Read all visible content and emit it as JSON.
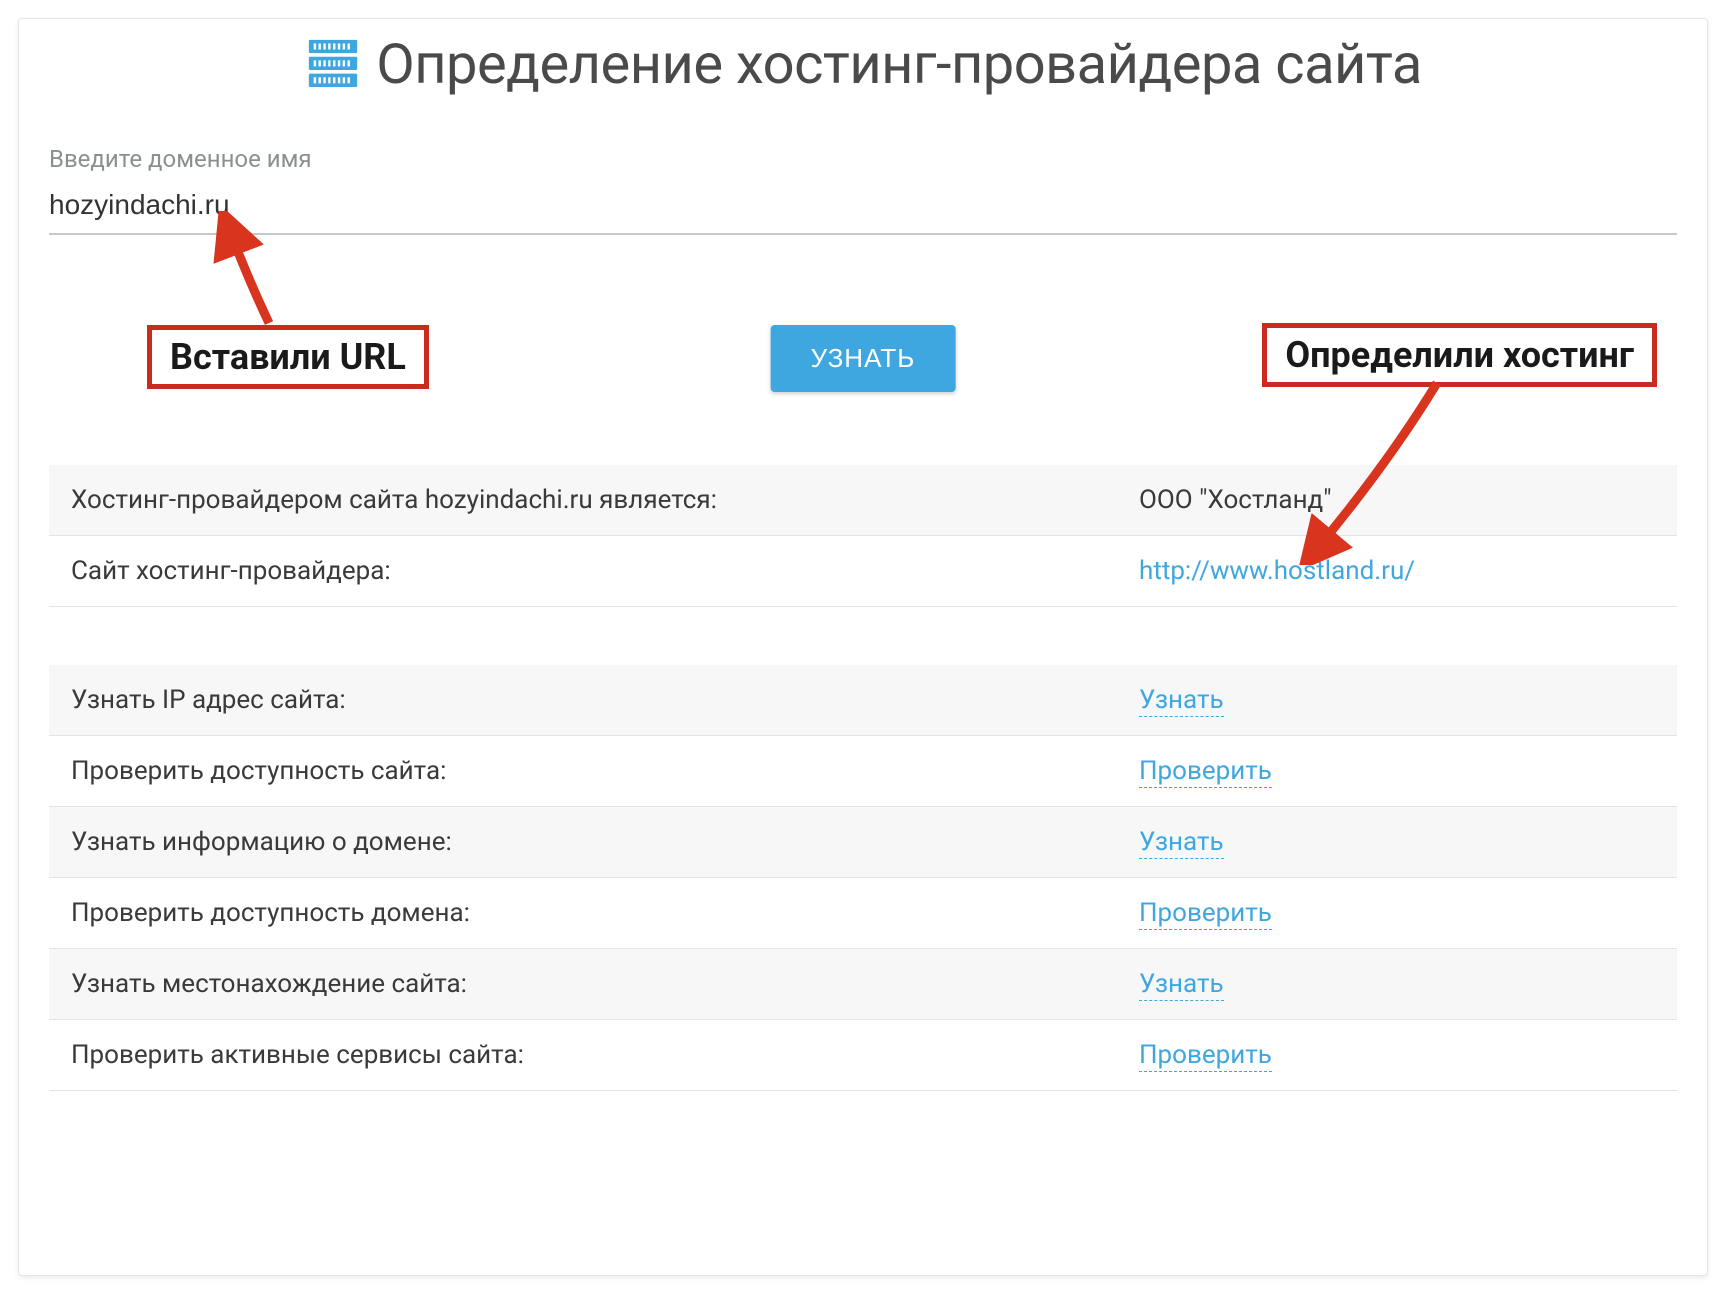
{
  "header": {
    "title": "Определение хостинг-провайдера сайта"
  },
  "form": {
    "label": "Введите доменное имя",
    "value": "hozyindachi.ru",
    "button": "УЗНАТЬ"
  },
  "annotations": {
    "left": "Вставили URL",
    "right": "Определили хостинг"
  },
  "result": {
    "provider_label": "Хостинг-провайдером сайта hozyindachi.ru является:",
    "provider_value": "ООО \"Хостланд\"",
    "site_label": "Сайт хостинг-провайдера:",
    "site_value": "http://www.hostland.ru/"
  },
  "tools": [
    {
      "label": "Узнать IP адрес сайта:",
      "action": "Узнать"
    },
    {
      "label": "Проверить доступность сайта:",
      "action": "Проверить"
    },
    {
      "label": "Узнать информацию о домене:",
      "action": "Узнать"
    },
    {
      "label": "Проверить доступность домена:",
      "action": "Проверить"
    },
    {
      "label": "Узнать местонахождение сайта:",
      "action": "Узнать"
    },
    {
      "label": "Проверить активные сервисы сайта:",
      "action": "Проверить"
    }
  ]
}
